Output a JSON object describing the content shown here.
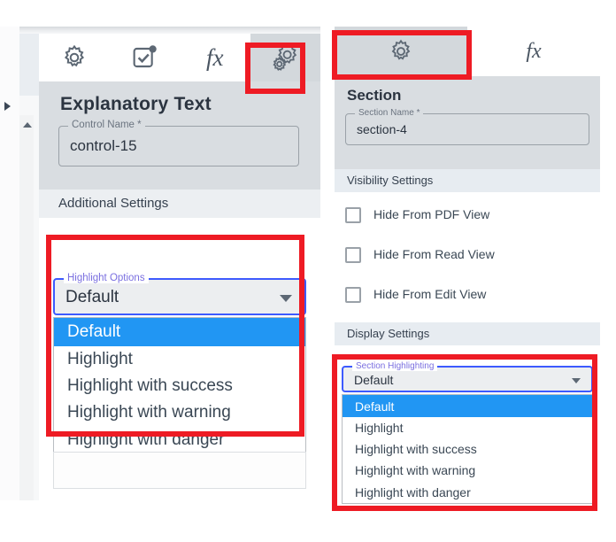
{
  "left_panel": {
    "tabs": [
      {
        "name": "general-settings",
        "icon": "gear-icon",
        "active": false
      },
      {
        "name": "validation-settings",
        "icon": "checkbox-badge-icon",
        "active": false
      },
      {
        "name": "formula-settings",
        "icon": "fx-icon",
        "label": "fx",
        "active": false
      },
      {
        "name": "advanced-settings",
        "icon": "double-gear-icon",
        "active": true
      }
    ],
    "title": "Explanatory Text",
    "control_name_field": {
      "legend": "Control Name *",
      "value": "control-15"
    },
    "section_header": "Additional Settings",
    "highlight_dropdown": {
      "legend": "Highlight Options",
      "value": "Default",
      "options": [
        "Default",
        "Highlight",
        "Highlight with success",
        "Highlight with warning",
        "Highlight with danger"
      ],
      "selected_index": 0
    }
  },
  "right_panel": {
    "tabs": [
      {
        "name": "section-settings",
        "icon": "gear-icon",
        "active": true
      },
      {
        "name": "formula-settings",
        "icon": "fx-icon",
        "label": "fx",
        "active": false
      }
    ],
    "title": "Section",
    "section_name_field": {
      "legend": "Section Name *",
      "value": "section-4"
    },
    "visibility_header": "Visibility Settings",
    "checkboxes": [
      {
        "label": "Hide From PDF View",
        "checked": false
      },
      {
        "label": "Hide From Read View",
        "checked": false
      },
      {
        "label": "Hide From Edit View",
        "checked": false
      }
    ],
    "display_header": "Display Settings",
    "highlight_dropdown": {
      "legend": "Section Highlighting",
      "value": "Default",
      "options": [
        "Default",
        "Highlight",
        "Highlight with success",
        "Highlight with warning",
        "Highlight with danger"
      ],
      "selected_index": 0
    }
  },
  "colors": {
    "annotation_red": "#ee1b24",
    "dropdown_focus_blue": "#3d5afe",
    "selected_item_blue": "#2196f3",
    "legend_purple": "#7a6fe0",
    "panel_grey": "#d9dde1",
    "icon_grey": "#5d6874"
  }
}
